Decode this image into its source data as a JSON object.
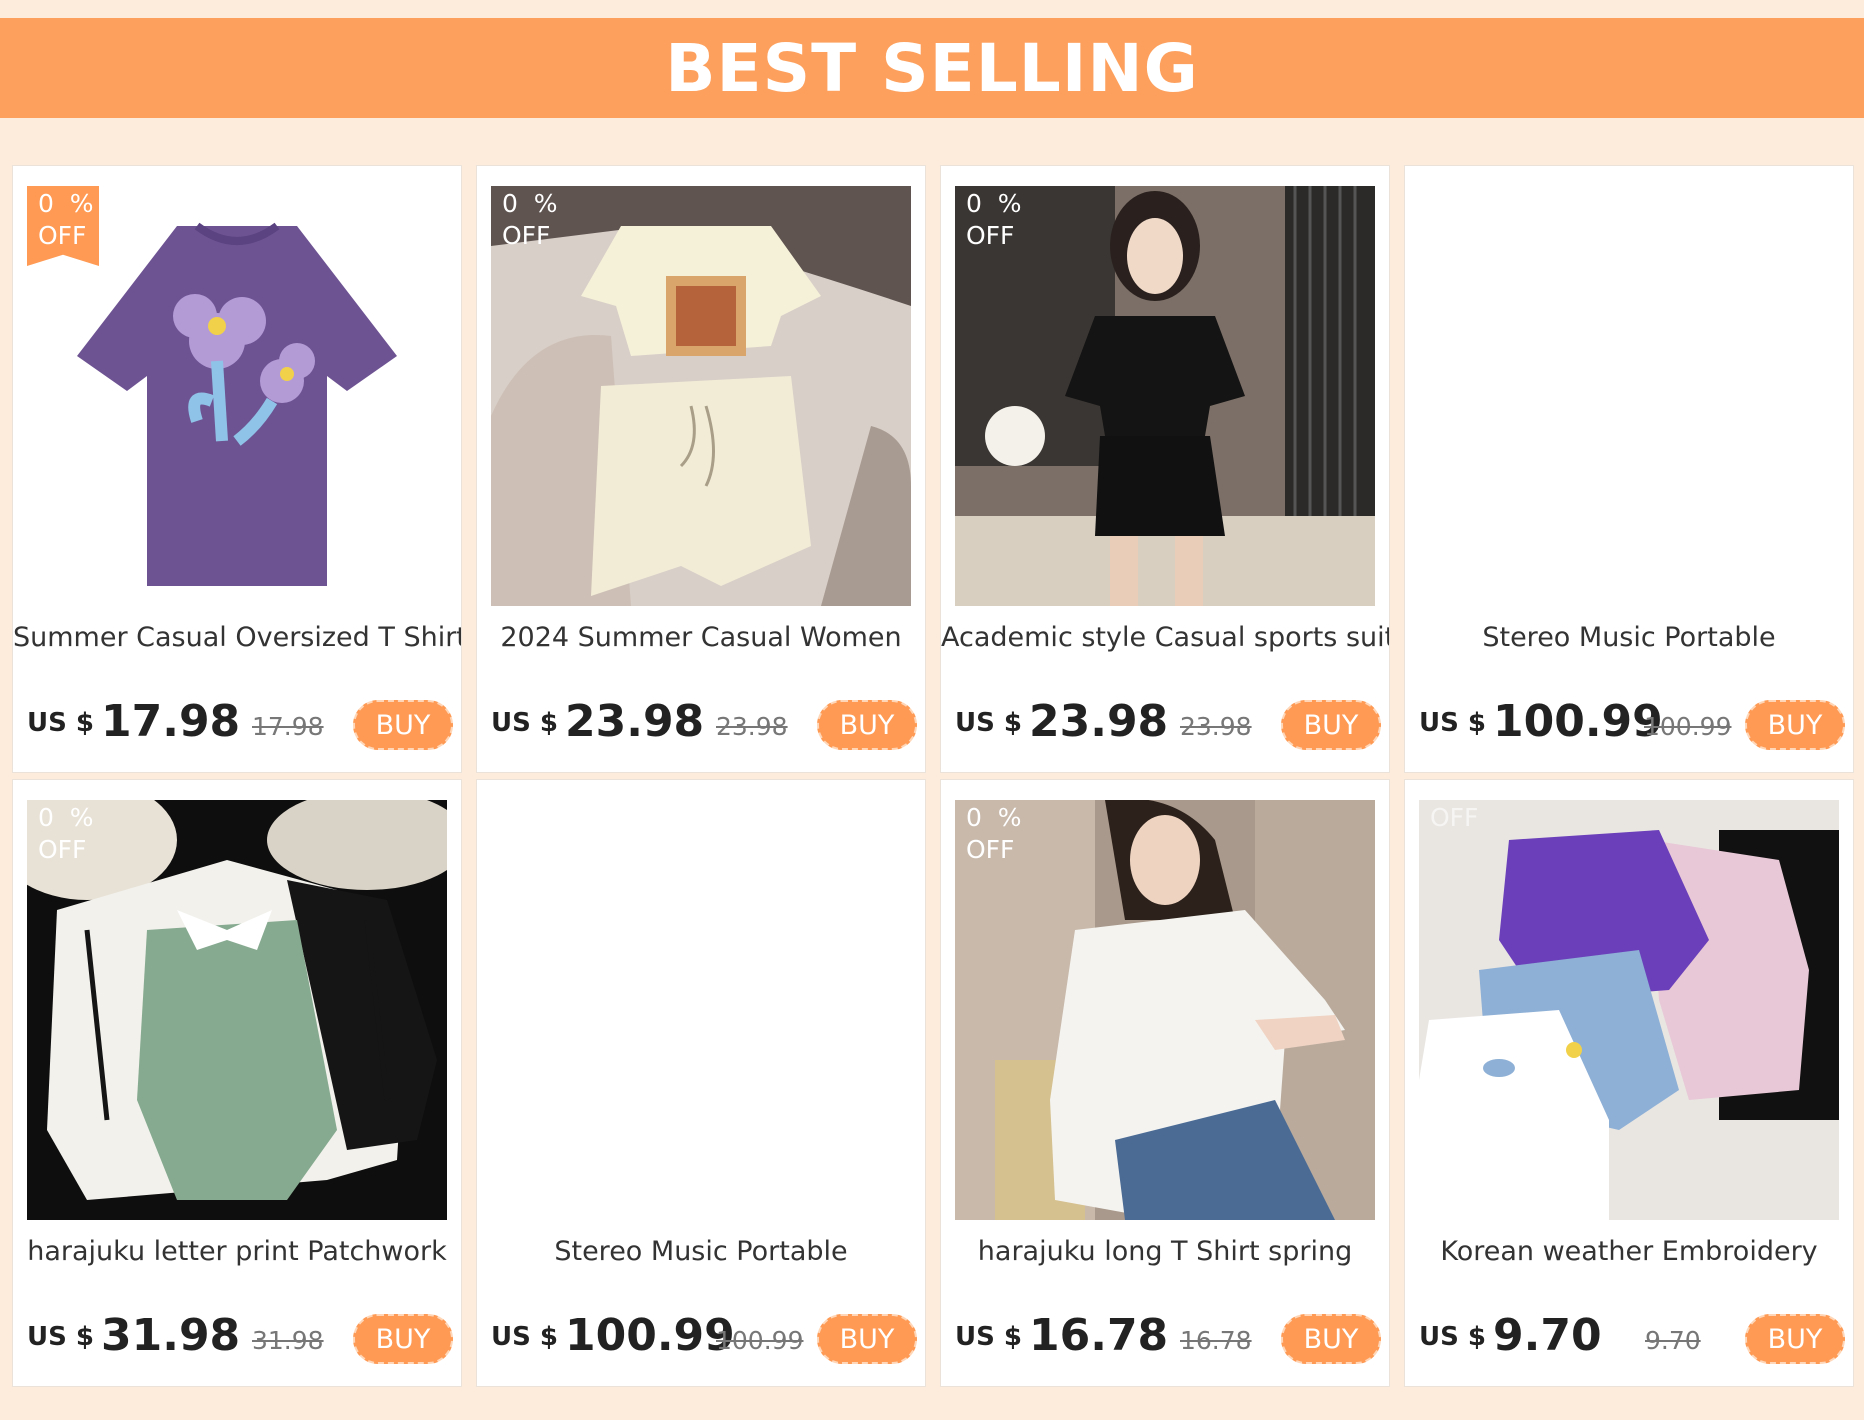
{
  "banner": {
    "title": "BEST SELLING"
  },
  "colors": {
    "accent": "#fea05d",
    "background": "#fdebdb",
    "button": "#fe9a54"
  },
  "buy_label": "BUY",
  "products": [
    {
      "title": "Summer Casual Oversized T Shirt",
      "currency": "US $",
      "price": "17.98",
      "old_price": "17.98",
      "badge_pct": "0  %",
      "badge_off": "OFF",
      "image": "purple-tshirt"
    },
    {
      "title": "2024 Summer Casual Women",
      "currency": "US $",
      "price": "23.98",
      "old_price": "23.98",
      "badge_pct": "0  %",
      "badge_off": "OFF",
      "image": "cream-set"
    },
    {
      "title": "Academic style Casual sports suit",
      "currency": "US $",
      "price": "23.98",
      "old_price": "23.98",
      "badge_pct": "0  %",
      "badge_off": "OFF",
      "image": "black-set"
    },
    {
      "title": "Stereo Music Portable",
      "currency": "US $",
      "price": "100.99",
      "old_price": "100.99",
      "badge_pct": "",
      "badge_off": "",
      "image": ""
    },
    {
      "title": "harajuku letter print Patchwork",
      "currency": "US $",
      "price": "31.98",
      "old_price": "31.98",
      "badge_pct": "0  %",
      "badge_off": "OFF",
      "image": "layered-sweatshirts"
    },
    {
      "title": "Stereo Music Portable",
      "currency": "US $",
      "price": "100.99",
      "old_price": "100.99",
      "badge_pct": "",
      "badge_off": "",
      "image": ""
    },
    {
      "title": "harajuku long T Shirt spring",
      "currency": "US $",
      "price": "16.78",
      "old_price": "16.78",
      "badge_pct": "0  %",
      "badge_off": "OFF",
      "image": "white-longsleeve"
    },
    {
      "title": "Korean weather Embroidery",
      "currency": "US $",
      "price": "9.70",
      "old_price": "9.70",
      "badge_pct": "",
      "badge_off": "OFF",
      "image": "tshirt-pile"
    }
  ]
}
